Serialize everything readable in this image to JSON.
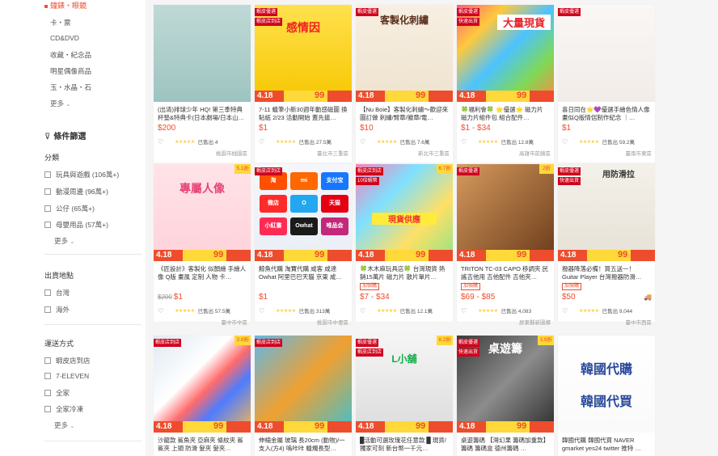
{
  "sidebar": {
    "category_top": "鐘錶・眼鏡",
    "categories": [
      "卡・票",
      "CD&DVD",
      "收藏・紀念品",
      "明星偶像商品",
      "玉・水晶・石"
    ],
    "more_label": "更多",
    "filter_title": "條件篩選",
    "sections": {
      "category": {
        "title": "分類",
        "options": [
          "玩具與遊戲 (106萬+)",
          "動漫周邊 (96萬+)",
          "公仔 (65萬+)",
          "母嬰用品 (57萬+)"
        ]
      },
      "origin": {
        "title": "出貨地點",
        "options": [
          "台灣",
          "海外"
        ]
      },
      "shipping": {
        "title": "運送方式",
        "options": [
          "蝦皮店到店",
          "7-ELEVEN",
          "全家",
          "全家冷凍"
        ]
      }
    }
  },
  "promo": {
    "left": "4.18",
    "right": "99"
  },
  "icons": {
    "heart": "heart-outline-icon",
    "truck": "free-shipping-truck-icon",
    "chevron": "chevron-down-icon",
    "filter": "filter-icon"
  },
  "colors": {
    "accent": "#ee4d2d",
    "badge_red": "#d0011b",
    "badge_yellow": "#ffd839",
    "star": "#ffce3d"
  },
  "products": [
    {
      "title": "(出清)排球少年 HQ! 第三季特典 杯墊&特典卡(日本劇場/日本山…",
      "price": "$200",
      "sold": "已售出 4",
      "loc": "桃園市桃園區",
      "badges": [],
      "yellow": "",
      "tag": ""
    },
    {
      "title": "7-11 蠟筆小新30週年動感磁圖 換貼紙 2/23 活動開始 蓋先搶…",
      "price": "$1",
      "sold": "已售出 27.5萬",
      "loc": "臺北市三重區",
      "badges": [
        "蝦皮優選",
        "蝦皮店到店"
      ],
      "yellow": "",
      "tag": ""
    },
    {
      "title": "【Nu Boie】客製化刺繡～歡迎來圖訂做 刺繡/臂章/徽章/電…",
      "price": "$10",
      "sold": "已售出 7.6萬",
      "loc": "新北市三重區",
      "badges": [
        "蝦皮優選"
      ],
      "yellow": "",
      "tag": ""
    },
    {
      "title": "🍀福利會🍀 🌟優選🌟 磁力片 磁力片組件包 組合配件…",
      "price": "$1 - $34",
      "sold": "已售出 12.8萬",
      "loc": "高雄市前鎮區",
      "badges": [
        "蝦皮優選",
        "快速出貨"
      ],
      "yellow": "",
      "tag": ""
    },
    {
      "title": "喜日同在🌟💜優選手繪色情人像 畫似Q版情侶制作紀念 ｜…",
      "price": "$1",
      "sold": "已售出 59.2萬",
      "loc": "臺南市東區",
      "badges": [
        "蝦皮優選"
      ],
      "yellow": "",
      "tag": ""
    },
    {
      "title": "《匠設計》客製化 似顏繪 手繪人像 Q版 畫風 定制 人物 卡…",
      "price": "$1",
      "orig": "$200",
      "sold": "已售出 57.5萬",
      "loc": "臺中市中區",
      "badges": [],
      "yellow": "5.1折",
      "tag": ""
    },
    {
      "title": "鯨魚代購 淘寶代購 咸客 咸達 Owhat 阿里巴巴天貓 京東 咸…",
      "price": "$1",
      "sold": "已售出 313萬",
      "loc": "桃園市中壢區",
      "badges": [
        "蝦皮店到店"
      ],
      "yellow": "",
      "tag": ""
    },
    {
      "title": "🍀木木麻玩具店🍀 台灣現貨 熱銷15萬片 磁力片 散片單片…",
      "price": "$7 - $34",
      "sold": "已售出 12.1萬",
      "loc": "",
      "badges": [
        "蝦皮店到店",
        "10倍蝦幣"
      ],
      "yellow": "6.7折",
      "tag": "加價購"
    },
    {
      "title": "TRITON TC-03 CAPO 移調夾 民謠吉他用 吉他配件 吉他夾…",
      "price": "$69 - $85",
      "sold": "已售出 4,083",
      "loc": "屏東縣新園鄉",
      "badges": [
        "蝦皮優選"
      ],
      "yellow": "2折",
      "tag": "加價購"
    },
    {
      "title": "撥器降落必備！買五送一！Guitar Player 台灣撥器防滑…",
      "price": "$50",
      "sold": "已售出 9,044",
      "loc": "臺中市西區",
      "badges": [
        "蝦皮優選",
        "快速出貨"
      ],
      "yellow": "",
      "tag": "加價購"
    },
    {
      "title": "沙龍款 鯊魚夾 亞麻夾 條紋夾 鯊鯊夾 上頭 防滑 髮夾 髮夾…",
      "price": "",
      "sold": "",
      "loc": "",
      "badges": [
        "蝦皮店到店"
      ],
      "yellow": "3.8折",
      "tag": ""
    },
    {
      "title": "伸縮金屬 玻璃 長20cm (動物)/一支入(方4) 嗚咔咔 蠟燭長型…",
      "price": "",
      "sold": "",
      "loc": "",
      "badges": [
        "蝦皮店到店"
      ],
      "yellow": "",
      "tag": ""
    },
    {
      "title": "█活動可選玫瑰花任意款 █ 現貨/獨家可刻 新台幣一千元…",
      "price": "",
      "sold": "",
      "loc": "",
      "badges": [
        "蝦皮優選",
        "蝦皮店到店"
      ],
      "yellow": "8.2折",
      "tag": ""
    },
    {
      "title": "桌遊籌碼 【灣幻果 籌碼加重款】 籌碼 籌碼盒 德州籌碼 …",
      "price": "",
      "sold": "",
      "loc": "",
      "badges": [
        "蝦皮優選",
        "快速出貨"
      ],
      "yellow": "3.9折",
      "tag": ""
    },
    {
      "title": "韓國代購 韓國代買 NAVER gmarket yes24 twitter 推特 …",
      "price": "",
      "sold": "",
      "loc": "",
      "badges": [],
      "yellow": "",
      "tag": ""
    }
  ],
  "thumbs": {
    "t7": [
      "淘",
      "mi",
      "支付宝",
      "微店",
      "O",
      "天猫",
      "小紅書",
      "Owhat",
      "唯品会"
    ],
    "t2": "感情因",
    "t3": "客製化刺繡",
    "t4": "大量現貨",
    "t6": "專屬人像",
    "t10": "用防滑拉",
    "t14": "桌遊籌",
    "t15a": "韓國代購",
    "t15b": "韓國代買",
    "t13": "L小舖",
    "t8": "現貨供應"
  }
}
